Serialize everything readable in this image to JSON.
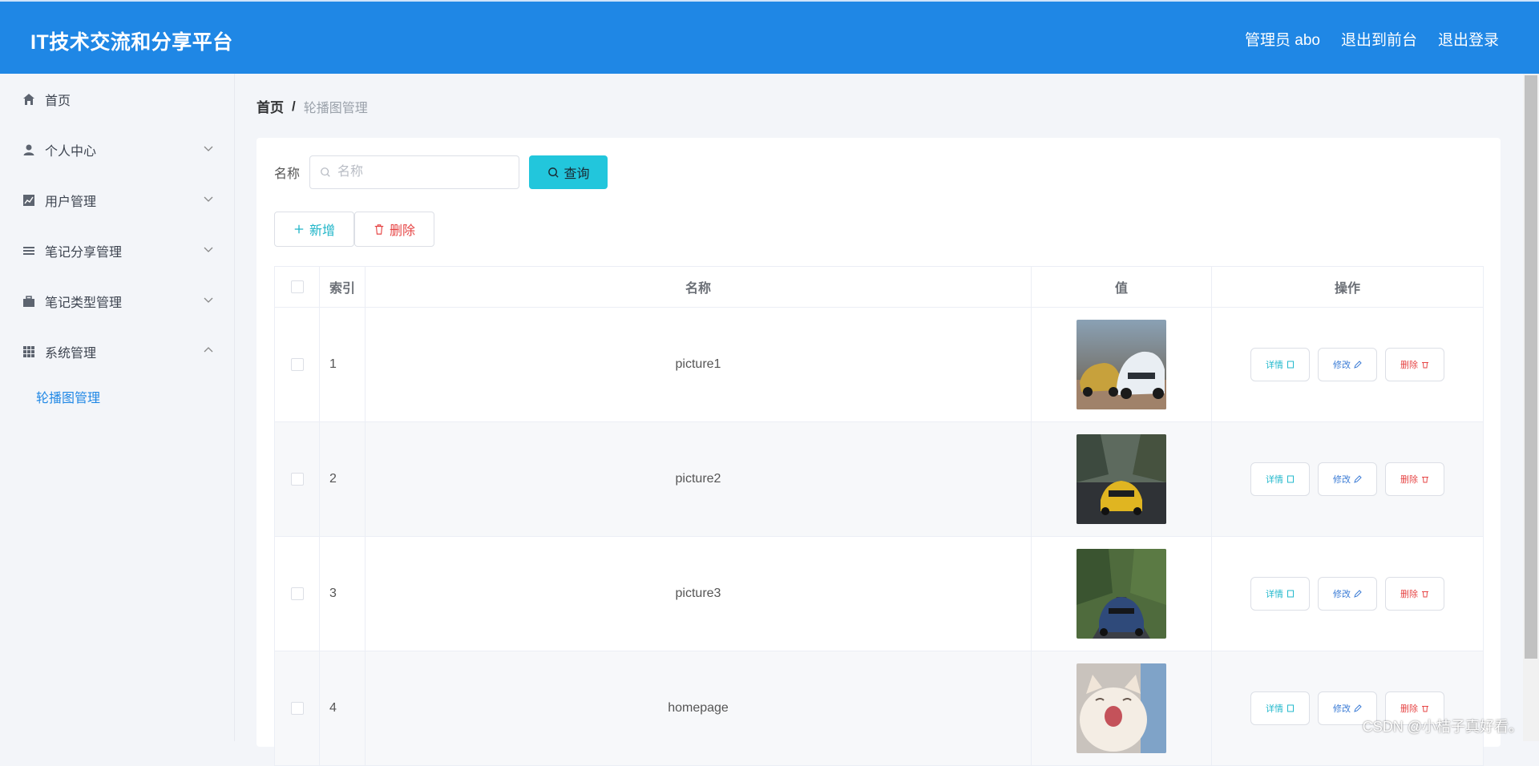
{
  "header": {
    "title": "IT技术交流和分享平台",
    "admin": "管理员 abo",
    "exit_front": "退出到前台",
    "logout": "退出登录"
  },
  "sidebar": {
    "items": [
      {
        "label": "首页",
        "icon": "home-icon"
      },
      {
        "label": "个人中心",
        "icon": "user-icon"
      },
      {
        "label": "用户管理",
        "icon": "chart-icon"
      },
      {
        "label": "笔记分享管理",
        "icon": "list-icon"
      },
      {
        "label": "笔记类型管理",
        "icon": "briefcase-icon"
      },
      {
        "label": "系统管理",
        "icon": "grid-icon"
      }
    ],
    "sub_active": "轮播图管理"
  },
  "breadcrumb": {
    "home": "首页",
    "sep": "/",
    "current": "轮播图管理"
  },
  "search": {
    "label": "名称",
    "placeholder": "名称",
    "button": "查询"
  },
  "actions": {
    "add": "新增",
    "delete": "删除"
  },
  "table": {
    "headers": {
      "index": "索引",
      "name": "名称",
      "value": "值",
      "ops": "操作"
    },
    "ops": {
      "detail": "详情",
      "edit": "修改",
      "delete": "删除"
    },
    "rows": [
      {
        "index": "1",
        "name": "picture1"
      },
      {
        "index": "2",
        "name": "picture2"
      },
      {
        "index": "3",
        "name": "picture3"
      },
      {
        "index": "4",
        "name": "homepage"
      }
    ]
  },
  "watermark": "CSDN @小桔子真好看。",
  "colors": {
    "primary": "#1f87e5",
    "query": "#22c6dc",
    "danger": "#e64545"
  }
}
